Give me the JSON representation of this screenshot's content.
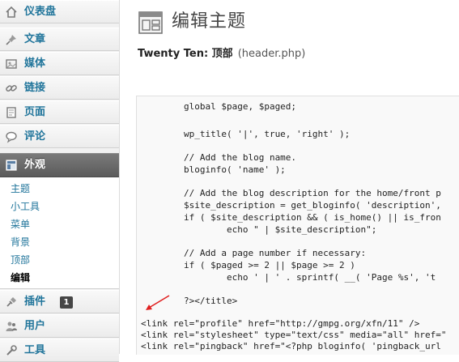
{
  "sidebar": {
    "items": [
      {
        "label": "仪表盘",
        "icon": "dashboard-icon"
      },
      {
        "label": "文章",
        "icon": "pushpin-icon"
      },
      {
        "label": "媒体",
        "icon": "media-icon"
      },
      {
        "label": "链接",
        "icon": "link-icon"
      },
      {
        "label": "页面",
        "icon": "page-icon"
      },
      {
        "label": "评论",
        "icon": "comment-icon"
      },
      {
        "label": "外观",
        "icon": "appearance-icon"
      },
      {
        "label": "插件",
        "icon": "plugin-icon",
        "badge": "1"
      },
      {
        "label": "用户",
        "icon": "users-icon"
      },
      {
        "label": "工具",
        "icon": "tools-icon"
      }
    ],
    "submenu": [
      "主题",
      "小工具",
      "菜单",
      "背景",
      "顶部",
      "编辑"
    ],
    "current_item": "外观",
    "current_submenu": "编辑"
  },
  "main": {
    "title": "编辑主题",
    "theme_name": "Twenty Ten: 顶部",
    "file_name": "(header.php)",
    "code_lines": [
      "        global $page, $paged;",
      "",
      "        wp_title( '|', true, 'right' );",
      "",
      "        // Add the blog name.",
      "        bloginfo( 'name' );",
      "",
      "        // Add the blog description for the home/front p",
      "        $site_description = get_bloginfo( 'description',",
      "        if ( $site_description && ( is_home() || is_fron",
      "                echo \" | $site_description\";",
      "",
      "        // Add a page number if necessary:",
      "        if ( $paged >= 2 || $page >= 2 )",
      "                echo ' | ' . sprintf( __( 'Page %s', 't",
      "",
      "        ?></title>",
      "",
      "<link rel=\"profile\" href=\"http://gmpg.org/xfn/11\" />",
      "<link rel=\"stylesheet\" type=\"text/css\" media=\"all\" href=\"",
      "<link rel=\"pingback\" href=\"<?php bloginfo( 'pingback_url"
    ]
  },
  "colors": {
    "link": "#21759b",
    "current_menu": "#5b5b5b",
    "annotation_arrow": "#e02020"
  }
}
